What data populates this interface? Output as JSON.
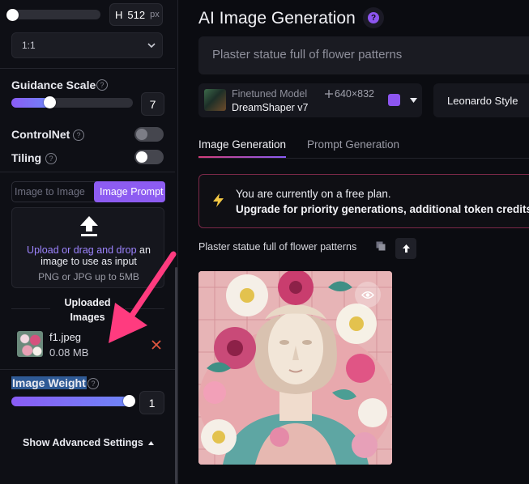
{
  "sidebar": {
    "height_label": "H",
    "height_value": "512",
    "height_unit": "px",
    "aspect_ratio": "1:1",
    "guidance": {
      "label": "Guidance Scale",
      "value": "7",
      "fraction": 0.33
    },
    "controlnet_label": "ControlNet",
    "tiling_label": "Tiling",
    "tabs": {
      "image_to_image": "Image to Image",
      "image_prompt": "Image Prompt"
    },
    "upload": {
      "link_text": "Upload or drag and drop",
      "text_an": "an",
      "text_rest": "image to use as input",
      "hint": "PNG or JPG up to 5MB"
    },
    "uploaded": {
      "header_line1": "Uploaded",
      "header_line2": "Images",
      "file_name": "f1.jpeg",
      "file_size": "0.08 MB"
    },
    "image_weight": {
      "label": "Image Weight",
      "value": "1",
      "fraction": 1.0
    },
    "advanced_label": "Show Advanced Settings"
  },
  "main": {
    "title": "AI Image Generation",
    "prompt_placeholder": "Plaster statue full of flower patterns",
    "model": {
      "type": "Finetuned Model",
      "dims": "640×832",
      "name": "DreamShaper v7"
    },
    "style": "Leonardo Style",
    "tabs": {
      "image_generation": "Image Generation",
      "prompt_generation": "Prompt Generation"
    },
    "banner": {
      "line1": "You are currently on a free plan.",
      "line2": "Upgrade for priority generations, additional token credits, a"
    },
    "result": {
      "prompt": "Plaster statue full of flower patterns"
    }
  },
  "colors": {
    "accent": "#8a5cf6",
    "arrow": "#ff3b7f",
    "danger": "#e0563f",
    "banner_border": "#7a2848"
  }
}
